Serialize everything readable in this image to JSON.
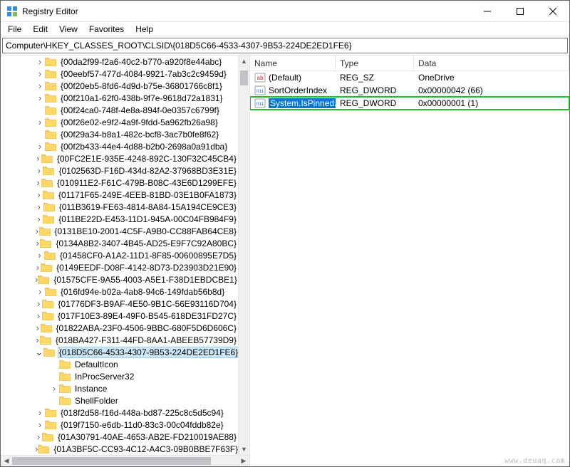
{
  "titlebar": {
    "title": "Registry Editor"
  },
  "menubar": {
    "items": [
      "File",
      "Edit",
      "View",
      "Favorites",
      "Help"
    ]
  },
  "addressbar": {
    "path": "Computer\\HKEY_CLASSES_ROOT\\CLSID\\{018D5C66-4533-4307-9B53-224DE2ED1FE6}"
  },
  "tree": {
    "base_indent": 62,
    "items": [
      {
        "expand": ">",
        "label": "{00da2f99-f2a6-40c2-b770-a920f8e44abc}",
        "indent": 62
      },
      {
        "expand": ">",
        "label": "{00eebf57-477d-4084-9921-7ab3c2c9459d}",
        "indent": 62
      },
      {
        "expand": ">",
        "label": "{00f20eb5-8fd6-4d9d-b75e-36801766c8f1}",
        "indent": 62
      },
      {
        "expand": ">",
        "label": "{00f210a1-62f0-438b-9f7e-9618d72a1831}",
        "indent": 62
      },
      {
        "expand": "",
        "label": "{00f24ca0-748f-4e8a-894f-0e0357c6799f}",
        "indent": 62
      },
      {
        "expand": ">",
        "label": "{00f26e02-e9f2-4a9f-9fdd-5a962fb26a98}",
        "indent": 62
      },
      {
        "expand": "",
        "label": "{00f29a34-b8a1-482c-bcf8-3ac7b0fe8f62}",
        "indent": 62
      },
      {
        "expand": ">",
        "label": "{00f2b433-44e4-4d88-b2b0-2698a0a91dba}",
        "indent": 62
      },
      {
        "expand": ">",
        "label": "{00FC2E1E-935E-4248-892C-130F32C45CB4}",
        "indent": 62
      },
      {
        "expand": ">",
        "label": "{0102563D-F16D-434d-82A2-37968BD3E31E}",
        "indent": 62
      },
      {
        "expand": ">",
        "label": "{010911E2-F61C-479B-B08C-43E6D1299EFE}",
        "indent": 62
      },
      {
        "expand": ">",
        "label": "{01171F65-249E-4EEB-81BD-03E1B0FA1873}",
        "indent": 62
      },
      {
        "expand": ">",
        "label": "{011B3619-FE63-4814-8A84-15A194CE9CE3}",
        "indent": 62
      },
      {
        "expand": ">",
        "label": "{011BE22D-E453-11D1-945A-00C04FB984F9}",
        "indent": 62
      },
      {
        "expand": ">",
        "label": "{0131BE10-2001-4C5F-A9B0-CC88FAB64CE8}",
        "indent": 62
      },
      {
        "expand": ">",
        "label": "{0134A8B2-3407-4B45-AD25-E9F7C92A80BC}",
        "indent": 62
      },
      {
        "expand": ">",
        "label": "{01458CF0-A1A2-11D1-8F85-00600895E7D5}",
        "indent": 62
      },
      {
        "expand": ">",
        "label": "{0149EEDF-D08F-4142-8D73-D23903D21E90}",
        "indent": 62
      },
      {
        "expand": ">",
        "label": "{01575CFE-9A55-4003-A5E1-F38D1EBDCBE1}",
        "indent": 62
      },
      {
        "expand": ">",
        "label": "{016fd94e-b02a-4ab8-94c6-149fdab56b8d}",
        "indent": 62
      },
      {
        "expand": ">",
        "label": "{01776DF3-B9AF-4E50-9B1C-56E93116D704}",
        "indent": 62
      },
      {
        "expand": ">",
        "label": "{017F10E3-89E4-49F0-B545-618DE31FD27C}",
        "indent": 62
      },
      {
        "expand": ">",
        "label": "{01822ABA-23F0-4506-9BBC-680F5D6D606C}",
        "indent": 62
      },
      {
        "expand": ">",
        "label": "{018BA427-F311-44FD-8AA1-ABEEB57739D9}",
        "indent": 62
      },
      {
        "expand": "v",
        "label": "{018D5C66-4533-4307-9B53-224DE2ED1FE6}",
        "indent": 62,
        "selected": true
      },
      {
        "expand": "",
        "label": "DefaultIcon",
        "indent": 82
      },
      {
        "expand": "",
        "label": "InProcServer32",
        "indent": 82
      },
      {
        "expand": ">",
        "label": "Instance",
        "indent": 82
      },
      {
        "expand": "",
        "label": "ShellFolder",
        "indent": 82
      },
      {
        "expand": ">",
        "label": "{018f2d58-f16d-448a-bd87-225c8c5d5c94}",
        "indent": 62
      },
      {
        "expand": ">",
        "label": "{019f7150-e6db-11d0-83c3-00c04fddb82e}",
        "indent": 62
      },
      {
        "expand": ">",
        "label": "{01A30791-40AE-4653-AB2E-FD210019AE88}",
        "indent": 62
      },
      {
        "expand": ">",
        "label": "{01A3BF5C-CC93-4C12-A4C3-09B0BBE7F63F}",
        "indent": 62
      }
    ],
    "vscroll": {
      "thumb_top_pct": 1,
      "thumb_height_pct": 4
    },
    "hscroll": {
      "thumb_left_pct": 0,
      "thumb_width_pct": 88
    }
  },
  "list": {
    "columns": {
      "name": "Name",
      "type": "Type",
      "data": "Data"
    },
    "rows": [
      {
        "icon": "string",
        "name": "(Default)",
        "type": "REG_SZ",
        "data": "OneDrive"
      },
      {
        "icon": "binary",
        "name": "SortOrderIndex",
        "type": "REG_DWORD",
        "data": "0x00000042 (66)"
      },
      {
        "icon": "binary",
        "name": "System.IsPinned...",
        "type": "REG_DWORD",
        "data": "0x00000001 (1)",
        "highlighted": true
      }
    ]
  },
  "watermark": "www.deuaq.com"
}
